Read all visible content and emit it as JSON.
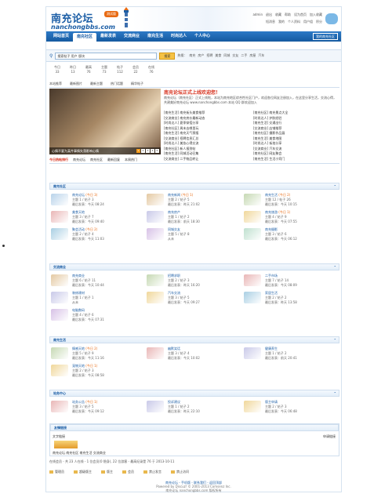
{
  "header": {
    "logo_cn": "南充论坛",
    "logo_en": "nanchongbbs.com",
    "badge": "测试版",
    "top_links": [
      "admin",
      "退出",
      "收藏",
      "帮助",
      "设为首页",
      "加入收藏"
    ],
    "top_links2": [
      "短消息",
      "我的",
      "个人资料",
      "用户组",
      "积分"
    ]
  },
  "nav": {
    "items": [
      "网站首页",
      "南充社区",
      "最新发表",
      "交流商业",
      "南充生活",
      "时尚达人",
      "个人中心"
    ],
    "active_index": 1,
    "right_label": "我的南充社区"
  },
  "search": {
    "value": "搜索帖子 用户 版块",
    "button": "搜索",
    "hot_label": "热搜：",
    "hot_items": [
      "南充",
      "房产",
      "招聘",
      "美食",
      "同城",
      "交友",
      "二手",
      "房屋",
      "汽车"
    ]
  },
  "stats": [
    {
      "label": "今日",
      "value": "33"
    },
    {
      "label": "昨日",
      "value": "13"
    },
    {
      "label": "最高",
      "value": "76"
    },
    {
      "label": "主题",
      "value": "73"
    },
    {
      "label": "帖子",
      "value": "112"
    },
    {
      "label": "会员",
      "value": "22"
    },
    {
      "label": "在线",
      "value": "76"
    }
  ],
  "featured": {
    "tabs": [
      "本站推荐",
      "最新图片",
      "最新主题",
      "热门话题",
      "精华帖子"
    ],
    "caption": "心情不要为某件事情失落影响心情",
    "pages": [
      "1",
      "2",
      "3",
      "4",
      "5"
    ],
    "title": "南充论坛正式上线欢迎您！",
    "desc": "南充论坛（南充社区）正式上线啦，本站为南充地区综合性社区门户，欢迎各位网友注册加入，在这里分享生活，交流心得，共建美好南充论坛 www.nanchongbbs.com 本站 QQ 群欢迎加入",
    "col1": [
      "[南充生活] 南充街头美食推荐",
      "[交流商业] 南充房价最新动态",
      "[时尚达人] 夏季穿搭分享",
      "[南充社区] 周末去哪里玩",
      "[南充生活] 南充天气预报",
      "[交流商业] 招聘信息汇总",
      "[时尚达人] 美妆心得交流",
      "[南充社区] 新人报到帖",
      "[南充生活] 同城活动召集",
      "[交流商业] 二手物品转让"
    ],
    "col2": [
      "[南充社区] 南充景点大全",
      "[时尚达人] 护肤经验",
      "[南充生活] 交通出行",
      "[交流商业] 店铺推荐",
      "[南充社区] 摄影作品展",
      "[南充生活] 美食地图",
      "[时尚达人] 街拍分享",
      "[交流商业] 汽车交流",
      "[南充社区] 网友聚会",
      "[南充生活] 生活小窍门"
    ]
  },
  "news_tabs": [
    "今日热帖排行",
    "南充论坛",
    "南充社区",
    "最新回复",
    "本周热门"
  ],
  "sections": [
    {
      "title": "南充社区",
      "forums": [
        {
          "name": "南充论坛",
          "new": "(今日 3)",
          "stat": "主题 1 / 帖子 3",
          "last": "最后发表：今天 08:24"
        },
        {
          "name": "南充新闻",
          "new": "(今日 1)",
          "stat": "主题 2 / 帖子 5",
          "last": "最后发表：昨天 21:02"
        },
        {
          "name": "南充生活",
          "new": "(今日 2)",
          "stat": "主题 12 / 帖子 26",
          "last": "最后发表：今天 10:15"
        },
        {
          "name": "美食天地",
          "new": "",
          "stat": "主题 3 / 帖子 7",
          "last": "最后发表：今天 09:40"
        },
        {
          "name": "南充房产",
          "new": "",
          "stat": "主题 1 / 帖子 2",
          "last": "最后发表：前天 18:30"
        },
        {
          "name": "南充旅游",
          "new": "(今日 1)",
          "stat": "主题 4 / 帖子 9",
          "last": "最后发表：今天 07:55"
        },
        {
          "name": "聚会活动",
          "new": "(今日 2)",
          "stat": "主题 2 / 帖子 4",
          "last": "最后发表：今天 11:03"
        },
        {
          "name": "同城交友",
          "new": "",
          "stat": "主题 5 / 帖子 8",
          "last": "从未"
        },
        {
          "name": "南充摄影",
          "new": "",
          "stat": "主题 3 / 帖子 6",
          "last": "最后发表：今天 06:12"
        }
      ]
    },
    {
      "title": "交流商业",
      "forums": [
        {
          "name": "南充商业",
          "new": "",
          "stat": "主题 6 / 帖子 11",
          "last": "最后发表：今天 10:44"
        },
        {
          "name": "招聘求职",
          "new": "",
          "stat": "主题 2 / 帖子 3",
          "last": "最后发表：昨天 16:20"
        },
        {
          "name": "二手市场",
          "new": "",
          "stat": "主题 7 / 帖子 14",
          "last": "最后发表：今天 08:09"
        },
        {
          "name": "装修建材",
          "new": "",
          "stat": "主题 1 / 帖子 1",
          "last": "从未"
        },
        {
          "name": "汽车交流",
          "new": "",
          "stat": "主题 3 / 帖子 5",
          "last": "最后发表：今天 09:27"
        },
        {
          "name": "家居生活",
          "new": "",
          "stat": "主题 2 / 帖子 2",
          "last": "最后发表：昨天 13:58"
        },
        {
          "name": "电脑数码",
          "new": "",
          "stat": "主题 4 / 帖子 6",
          "last": "最后发表：今天 07:31"
        }
      ]
    },
    {
      "title": "南充生活",
      "forums": [
        {
          "name": "情感天地",
          "new": "(今日 2)",
          "stat": "主题 5 / 帖子 9",
          "last": "最后发表：今天 11:16"
        },
        {
          "name": "幽默笑话",
          "new": "",
          "stat": "主题 3 / 帖子 4",
          "last": "最后发表：今天 10:02"
        },
        {
          "name": "健康养生",
          "new": "",
          "stat": "主题 1 / 帖子 2",
          "last": "最后发表：前天 20:41"
        },
        {
          "name": "宠物天地",
          "new": "(今日 1)",
          "stat": "主题 2 / 帖子 3",
          "last": "最后发表：今天 08:58"
        }
      ]
    },
    {
      "title": "站务中心",
      "forums": [
        {
          "name": "站务公告",
          "new": "(今日 1)",
          "stat": "主题 3 / 帖子 5",
          "last": "最后发表：今天 09:12"
        },
        {
          "name": "投诉建议",
          "new": "",
          "stat": "主题 1 / 帖子 2",
          "last": "最后发表：昨天 22:10"
        },
        {
          "name": "版主申请",
          "new": "",
          "stat": "主题 2 / 帖子 3",
          "last": "最后发表：今天 06:48"
        }
      ]
    }
  ],
  "links": {
    "title": "友情链接",
    "label": "文字链接",
    "text": "南充论坛  南充社区  南充生活  交流商业",
    "right": "申请链接"
  },
  "online": "在线会员 - 共 23 人在线 - 1 位会员(0 隐身), 22 位游客 - 最高纪录是 76 于 2013-10-11",
  "legend": [
    "管理员",
    "超级版主",
    "版主",
    "会员",
    "禁止发言",
    "禁止访问"
  ],
  "footer": {
    "links": "南充论坛 - 手机版 - 联系我们 - 返回顶部",
    "line1": "Powered by Discuz! © 2001-2013 Comsenz Inc.",
    "line2": "南充论坛 nanchongbbs.com 版权所有"
  },
  "colors": {
    "brand": "#1c5ea6",
    "accent": "#e86a12",
    "title_red": "#d62f1b"
  }
}
